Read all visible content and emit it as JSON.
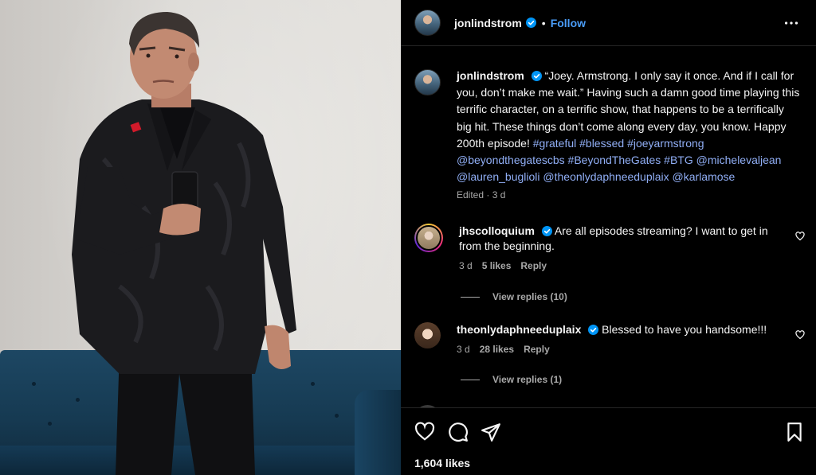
{
  "post": {
    "username": "jonlindstrom",
    "follow_label": "Follow",
    "dot": "•",
    "caption": {
      "text_plain": "“Joey. Armstrong. I only say it once. And if I call for you, don’t make me wait.” Having such a damn good time playing this terrific character, on a terrific show, that happens to be a terrifically big hit. These things don’t come along every day, you know. Happy 200th episode!",
      "tags": [
        "#grateful",
        "#blessed",
        "#joeyarmstrong",
        "@beyondthegatescbs",
        "#BeyondTheGates",
        "#BTG",
        "@michelevaljean",
        "@lauren_buglioli",
        "@theonlydaphneeduplaix",
        "@karlamose"
      ],
      "meta": "Edited · 3 d"
    },
    "likes": "1,604 likes"
  },
  "comments": [
    {
      "username": "jhscolloquium",
      "text": "Are all episodes streaming? I want to get in from the beginning.",
      "time": "3 d",
      "likes": "5 likes",
      "reply_label": "Reply",
      "view_replies": "View replies (10)"
    },
    {
      "username": "theonlydaphneeduplaix",
      "text": "Blessed to have you handsome!!!",
      "time": "3 d",
      "likes": "28 likes",
      "reply_label": "Reply",
      "view_replies": "View replies (1)"
    }
  ],
  "icons": {
    "verified": "verified-badge-icon",
    "more": "more-options-icon",
    "like": "heart-icon",
    "comment": "comment-icon",
    "share": "share-icon",
    "save": "bookmark-icon"
  },
  "colors": {
    "link": "#90aef5",
    "follow": "#4a9df8",
    "verified": "#0095f6",
    "muted": "#a8a8a8"
  }
}
